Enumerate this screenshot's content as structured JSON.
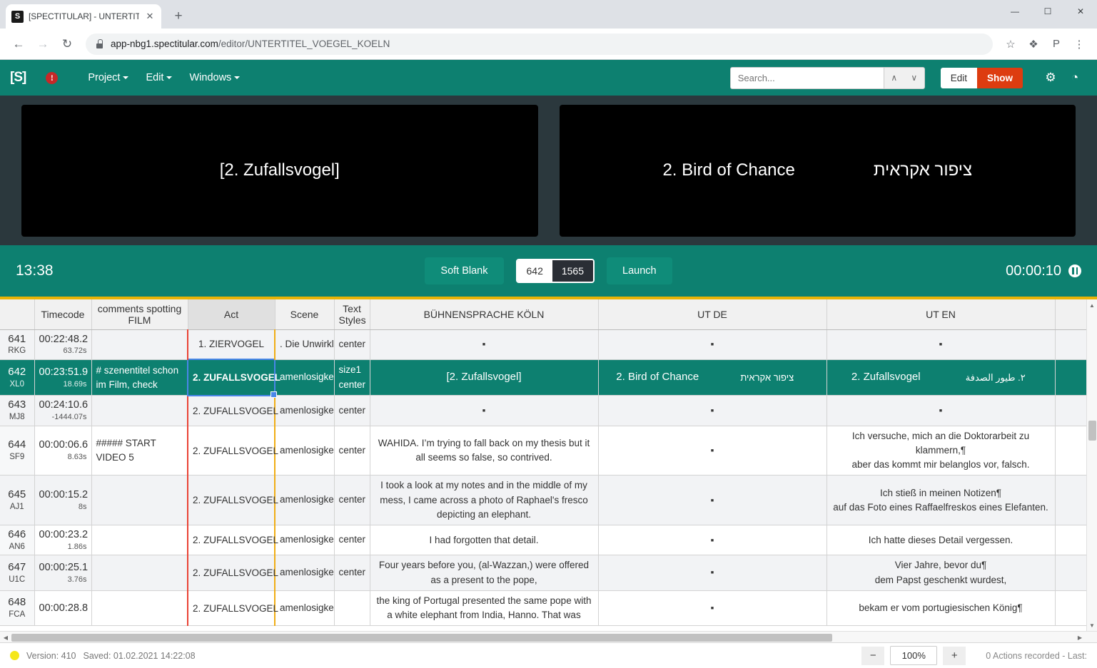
{
  "browser": {
    "tab_title": "[SPECTITULAR] - UNTERTITEL_VO",
    "favicon_glyph": "S",
    "close_glyph": "✕",
    "newtab_glyph": "+",
    "min_glyph": "—",
    "max_glyph": "☐",
    "win_close_glyph": "✕",
    "back_glyph": "←",
    "forward_glyph": "→",
    "reload_glyph": "↻",
    "url_host": "app-nbg1.spectitular.com",
    "url_path": "/editor/UNTERTITEL_VOEGEL_KOELN",
    "star_glyph": "☆",
    "extension_glyph": "❖",
    "profile_glyph": "P",
    "menu_glyph": "⋮"
  },
  "header": {
    "logo": "[S]",
    "alert_glyph": "!",
    "menus": [
      "Project",
      "Edit",
      "Windows"
    ],
    "search_placeholder": "Search...",
    "search_value": "",
    "search_prev_glyph": "∧",
    "search_next_glyph": "∨",
    "mode_edit": "Edit",
    "mode_show": "Show",
    "gear_glyph": "⚙",
    "account_glyph": "◔",
    "accent_color": "#0d8070",
    "show_color": "#dd3c10"
  },
  "preview": {
    "left": {
      "text": "[2. Zufallsvogel]"
    },
    "right": {
      "text_en": "2. Bird of Chance",
      "text_he": "ציפור אקראית"
    }
  },
  "transport": {
    "clock": "13:38",
    "soft_blank": "Soft Blank",
    "counter_current": "642",
    "counter_total": "1565",
    "launch": "Launch",
    "timecode": "00:00:10",
    "pause_glyph": ""
  },
  "grid": {
    "headers": {
      "id": "",
      "timecode": "Timecode",
      "comments": "comments spotting FILM",
      "act": "Act",
      "scene": "Scene",
      "styles": "Text Styles",
      "buehnensprache": "BÜHNENSPRACHE KÖLN",
      "ut_de": "UT DE",
      "ut_en": "UT EN",
      "end": ""
    },
    "rows": [
      {
        "num": "641",
        "code": "RKG",
        "tc": "00:22:48.2",
        "dur": "63.72s",
        "comment": "",
        "act": "1. ZIERVOGEL",
        "scene": ". Die Unwirklichkeit einer",
        "styles": "center",
        "bs": "▪",
        "de": "▪",
        "en": "▪",
        "selected": false,
        "stripe": "even"
      },
      {
        "num": "642",
        "code": "XL0",
        "tc": "00:23:51.9",
        "dur": "18.69s",
        "comment": "# szenentitel schon im Film, check",
        "act": "2. ZUFALLSVOGEL",
        "scene": "amenlosigkeit er Freuden un",
        "styles": "size1 center",
        "bs": "[2. Zufallsvogel]",
        "de_l": "2. Bird of Chance",
        "de_r": "ציפור אקראית",
        "en_l": "2. Zufallsvogel",
        "en_r": "٢. طيور الصدفة",
        "selected": true,
        "stripe": "sel"
      },
      {
        "num": "643",
        "code": "MJ8",
        "tc": "00:24:10.6",
        "dur": "-1444.07s",
        "comment": "",
        "act": "2. ZUFALLSVOGEL",
        "scene": "amenlosigkeit er Freuden un",
        "styles": "center",
        "bs": "▪",
        "de": "▪",
        "en": "▪",
        "selected": false,
        "stripe": "even"
      },
      {
        "num": "644",
        "code": "SF9",
        "tc": "00:00:06.6",
        "dur": "8.63s",
        "comment": "##### START VIDEO 5",
        "act": "2. ZUFALLSVOGEL",
        "scene": "amenlosigkeit er Freuden un eiden",
        "styles": "center",
        "bs": "WAHIDA. I’m trying to fall back on my thesis but it all seems so false, so contrived.",
        "de": "▪",
        "en": "Ich versuche, mich an die Doktorarbeit zu klammern,¶\naber das kommt mir belanglos vor, falsch.",
        "selected": false,
        "stripe": "odd"
      },
      {
        "num": "645",
        "code": "AJ1",
        "tc": "00:00:15.2",
        "dur": "8s",
        "comment": "",
        "act": "2. ZUFALLSVOGEL",
        "scene": "amenlosigkeit er Freuden un eiden",
        "styles": "center",
        "bs": "I took a look at my notes and in the middle of my mess, I came across a photo of Raphael's fresco depicting an elephant.",
        "de": "▪",
        "en": "Ich stieß in meinen Notizen¶\nauf das Foto eines Raffaelfreskos eines Elefanten.",
        "selected": false,
        "stripe": "even"
      },
      {
        "num": "646",
        "code": "AN6",
        "tc": "00:00:23.2",
        "dur": "1.86s",
        "comment": "",
        "act": "2. ZUFALLSVOGEL",
        "scene": "amenlosigkeit er Freuden un",
        "styles": "center",
        "bs": "I had forgotten that detail.",
        "de": "▪",
        "en": "Ich hatte dieses Detail vergessen.",
        "selected": false,
        "stripe": "odd"
      },
      {
        "num": "647",
        "code": "U1C",
        "tc": "00:00:25.1",
        "dur": "3.76s",
        "comment": "",
        "act": "2. ZUFALLSVOGEL",
        "scene": "amenlosigkeit er Freuden un",
        "styles": "center",
        "bs": "Four years before you, (al-Wazzan,) were offered as a present to the pope,",
        "de": "▪",
        "en": "Vier Jahre, bevor du¶\ndem Papst geschenkt wurdest,",
        "selected": false,
        "stripe": "even"
      },
      {
        "num": "648",
        "code": "FCA",
        "tc": "00:00:28.8",
        "dur": "",
        "comment": "",
        "act": "2. ZUFALLSVOGEL",
        "scene": "amenlosigke",
        "styles": "",
        "bs": "the king of Portugal presented the same pope with a white elephant from India, Hanno. That was",
        "de": "▪",
        "en": "bekam er vom portugiesischen König¶",
        "selected": false,
        "stripe": "odd"
      }
    ],
    "scroll": {
      "up_glyph": "▲",
      "down_glyph": "▼",
      "left_glyph": "◀",
      "right_glyph": "▶"
    }
  },
  "status": {
    "version": "Version: 410",
    "saved": "Saved: 01.02.2021 14:22:08",
    "zoom_minus": "−",
    "zoom_value": "100%",
    "zoom_plus": "+",
    "actions": "0 Actions recorded - Last:"
  }
}
